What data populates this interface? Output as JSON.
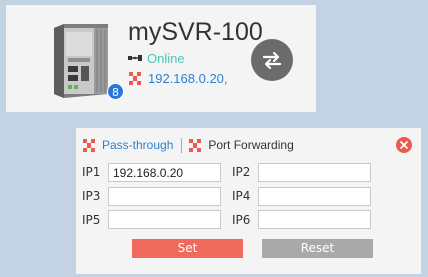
{
  "device": {
    "name": "mySVR-100",
    "status": "Online",
    "ip": "192.168.0.20,",
    "badge_count": "8",
    "status_color": "#4dc7b4",
    "link_color": "#2f80d1",
    "icons": {
      "device": "server-device-icon",
      "status": "ethernet-icon",
      "ip": "network-icon",
      "action": "swap-arrows-icon"
    }
  },
  "panel": {
    "tabs": [
      {
        "label": "Pass-through",
        "active": true,
        "icon": "network-icon"
      },
      {
        "label": "Port Forwarding",
        "active": false,
        "icon": "network-icon"
      }
    ],
    "fields": [
      {
        "label": "IP1",
        "value": "192.168.0.20"
      },
      {
        "label": "IP2",
        "value": ""
      },
      {
        "label": "IP3",
        "value": ""
      },
      {
        "label": "IP4",
        "value": ""
      },
      {
        "label": "IP5",
        "value": ""
      },
      {
        "label": "IP6",
        "value": ""
      }
    ],
    "set_label": "Set",
    "reset_label": "Reset",
    "close_icon": "close-icon",
    "colors": {
      "set": "#ef6a5d",
      "reset": "#a9a9a9",
      "close": "#e85b4e"
    }
  }
}
